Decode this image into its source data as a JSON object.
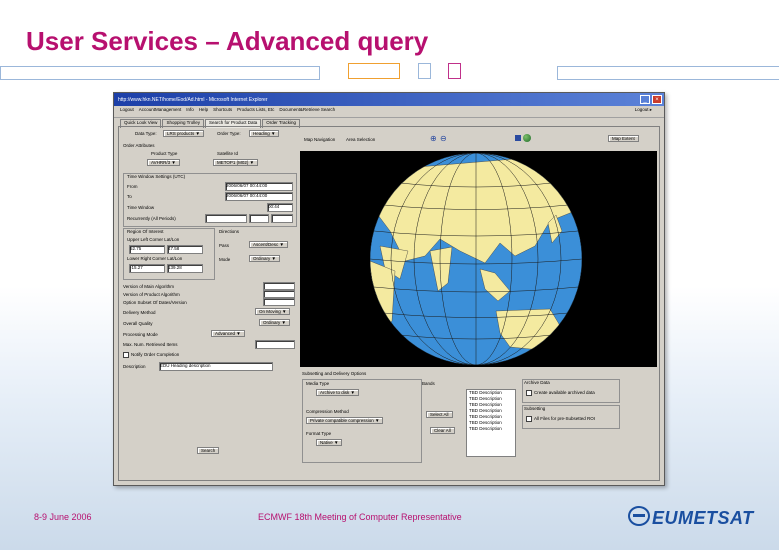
{
  "slide": {
    "title": "User Services – Advanced query",
    "footer_date": "8-9 June 2006",
    "footer_text": "ECMWF 18th Meeting of Computer Representative",
    "logo": "EUMETSAT",
    "colors": {
      "title": "#b7106f",
      "accent_orange": "#f0a030",
      "accent_blue": "#9bb7da",
      "accent_magenta": "#c0308a"
    }
  },
  "window": {
    "title": "http://www.hkn.NET/home/Eod/Ad.html - Microsoft Internet Explorer",
    "minimize": "_",
    "close": "×",
    "menu": [
      "Logout",
      "AccountManagement",
      "Info",
      "Help",
      "Shortcuts",
      "Products Lists, Etc",
      "Document&Retrieve Search"
    ],
    "logout_right": "Logout ▸",
    "tabs": [
      "Quick Look View",
      "Shopping Trolley",
      "Search for Product Data",
      "Order Tracking"
    ],
    "active_tab": 2
  },
  "left_panel": {
    "data_type_label": "Data Type:",
    "data_type_value": "LRS products ▼",
    "order_type_label": "Order Type:",
    "order_type_value": "Heading ▼",
    "order_attributes": "Order Attributes",
    "product_type_label": "Product Type",
    "product_type_value": "AVHRR/3 ▼",
    "satellite_label": "Satellite Id",
    "satellite_value": "METOP1 (M02) ▼",
    "time_window_title": "Time Window Settings (UTC)",
    "from_label": "From",
    "from_value": "2006/06/07 00:44:00",
    "to_label": "To",
    "to_value": "2006/06/07 00:44:00",
    "time_window_label": "Time Window",
    "time_window_value": "00:44",
    "recurrently_label": "Recurrently (All Periods)",
    "region_title": "Region Of Interest",
    "direction_title": "Directions",
    "upper_left_label": "Upper Left Corner Lat/Lon",
    "upper_left_lat": "52.75",
    "upper_left_lon": "47.58",
    "lower_right_label": "Lower Right Corner Lat/Lon",
    "lower_right_lat": "-15.27",
    "lower_right_lon": "139.28",
    "pass_label": "Pass",
    "pass_value": "Ascent/Desc ▼",
    "mode_label": "Mode",
    "mode_value": "Ordinary ▼",
    "rows": [
      "Version of Main Algorithm",
      "Version of Product Algorithm",
      "Option Subset Of Dates/Version"
    ],
    "delivery_label": "Delivery Method",
    "delivery_value": "On Moving ▼",
    "format_label": "Overall Quality",
    "format_value": "Ordinary ▼",
    "processing_label": "Processing Mode",
    "processing_value": "Advanced ▼",
    "max_label": "Max. Num. Retrieved Items",
    "notify_label": "Notify Order Completion",
    "description_label": "Description",
    "description_value": "EDU Heading description",
    "search_button": "Search"
  },
  "right_panel": {
    "map_nav_label": "Map Navigation",
    "area_selection_label": "Area Selection",
    "zoom_in": "⊕",
    "zoom_out": "⊖",
    "full_extent": "Map Extent",
    "sub_title": "Subsetting and Delivery Options",
    "media_label": "Media Type",
    "media_value": "Archive to disk ▼",
    "compression_label": "Compression Method",
    "compression_value": "Private compatible compression ▼",
    "format_type_label": "Format Type",
    "format_type_value": "Native ▼",
    "bands_label": "Bands",
    "select_all": "Select All",
    "clear_all": "Clear All",
    "bands": [
      "TBD Description",
      "TBD Description",
      "TBD Description",
      "TBD Description",
      "TBD Description",
      "TBD Description",
      "TBD Description"
    ],
    "archive_title": "Archive Data",
    "archive_opt": "Create available archived data",
    "subsetting_title": "Subsetting",
    "subsetting_opt": "All Files for pre-Subsetted ROI"
  }
}
